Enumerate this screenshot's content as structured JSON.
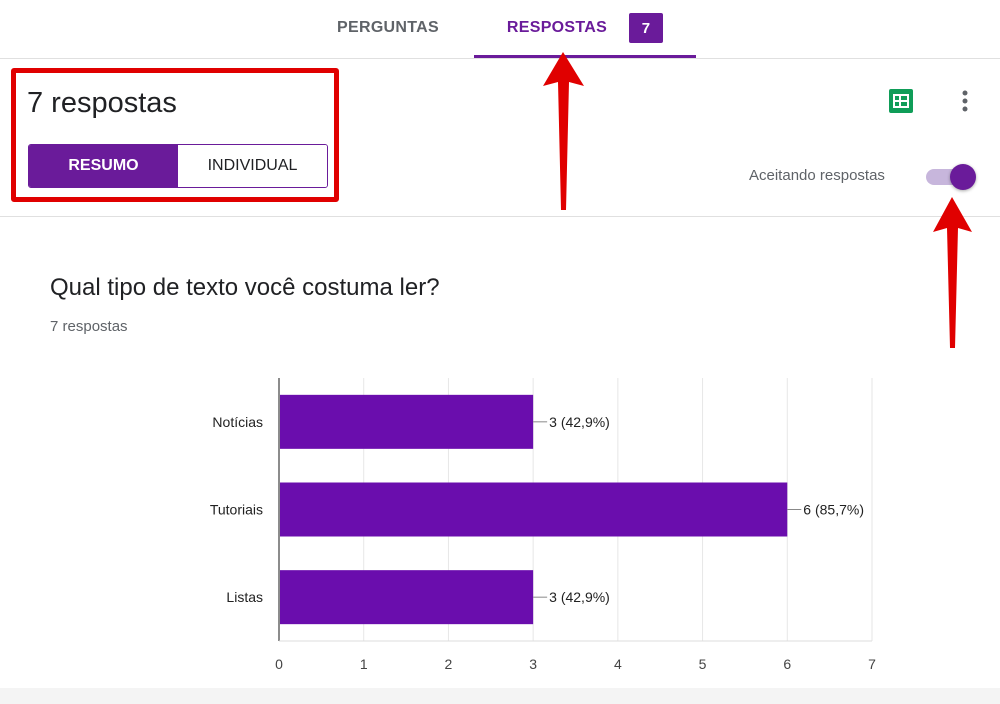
{
  "tabs": {
    "perguntas": "PERGUNTAS",
    "respostas": "RESPOSTAS",
    "respostas_badge": "7"
  },
  "summary": {
    "count_title": "7 respostas",
    "view_resumo": "RESUMO",
    "view_individual": "INDIVIDUAL",
    "accepting_label": "Aceitando respostas",
    "accepting_on": true
  },
  "question": {
    "title": "Qual tipo de texto você costuma ler?",
    "responses": "7 respostas"
  },
  "colors": {
    "accent": "#6a1b9a",
    "bar": "#6a0dad",
    "annotation": "#e00000",
    "sheets_icon": "#0f9d58"
  },
  "icons": [
    "google-sheets-icon",
    "more-vert-icon"
  ],
  "chart_data": {
    "type": "bar",
    "orientation": "horizontal",
    "categories": [
      "Notícias",
      "Tutoriais",
      "Listas"
    ],
    "values": [
      3,
      6,
      3
    ],
    "labels": [
      "3 (42,9%)",
      "6 (85,7%)",
      "3 (42,9%)"
    ],
    "xlim": [
      0,
      7
    ],
    "xticks": [
      0,
      1,
      2,
      3,
      4,
      5,
      6,
      7
    ],
    "grid": true
  }
}
